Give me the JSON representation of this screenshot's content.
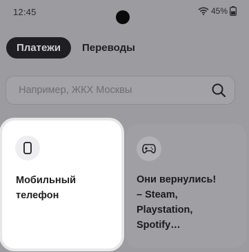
{
  "status_bar": {
    "time": "12:45",
    "battery": "45%",
    "icons": [
      "wifi-icon",
      "battery-icon"
    ]
  },
  "tabs": [
    {
      "label": "Платежи",
      "active": true
    },
    {
      "label": "Переводы",
      "active": false
    }
  ],
  "search": {
    "placeholder": "Например, ЖКХ Москвы",
    "icon": "search-icon"
  },
  "cards": [
    {
      "title": "Мобильный\nтелефон",
      "icon": "smartphone-icon",
      "highlighted": true
    },
    {
      "title": "Они вернулись!\n– Steam,\nPlaystation,\nSpotify…",
      "icon": "gamepad-icon",
      "highlighted": false
    }
  ],
  "colors": {
    "dim_background": "#9c9ba0",
    "active_tab": "#1f1f23",
    "highlight_card": "#ffffff"
  }
}
